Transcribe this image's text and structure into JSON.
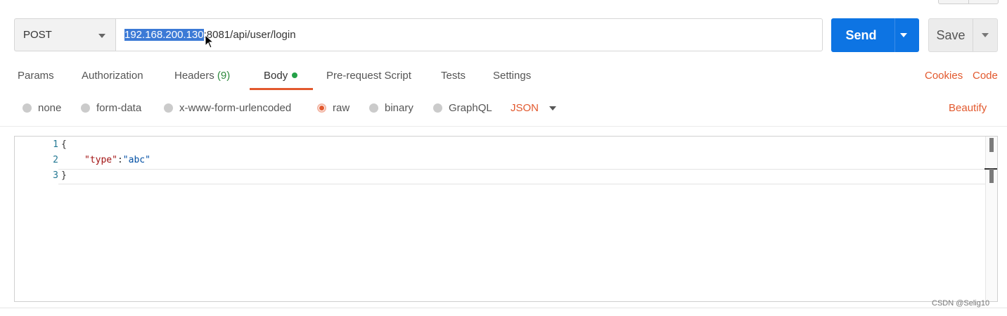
{
  "request": {
    "method": "POST",
    "url_selected": "192.168.200.130",
    "url_rest": ":8081/api/user/login",
    "send_label": "Send",
    "save_label": "Save"
  },
  "tabs": {
    "params": "Params",
    "authorization": "Authorization",
    "headers": "Headers",
    "headers_count": "(9)",
    "body": "Body",
    "prerequest": "Pre-request Script",
    "tests": "Tests",
    "settings": "Settings",
    "cookies": "Cookies",
    "code": "Code"
  },
  "body_types": {
    "none": "none",
    "form_data": "form-data",
    "urlencoded": "x-www-form-urlencoded",
    "raw": "raw",
    "binary": "binary",
    "graphql": "GraphQL",
    "selected": "raw",
    "format": "JSON",
    "beautify": "Beautify"
  },
  "editor": {
    "line_numbers": [
      "1",
      "2",
      "3"
    ],
    "open_brace": "{",
    "key": "\"type\"",
    "colon": ":",
    "value": "\"abc\"",
    "close_brace": "}"
  },
  "watermark": "CSDN @Selig10",
  "colors": {
    "accent": "#e2592e",
    "send_blue": "#0d74e3",
    "selection": "#3c7ad6",
    "body_dot": "#24a148"
  },
  "icons": {
    "method_dropdown": "chevron-down-icon",
    "send_dropdown": "chevron-down-icon",
    "save_dropdown": "chevron-down-icon",
    "mouse_cursor": "cursor-icon"
  }
}
